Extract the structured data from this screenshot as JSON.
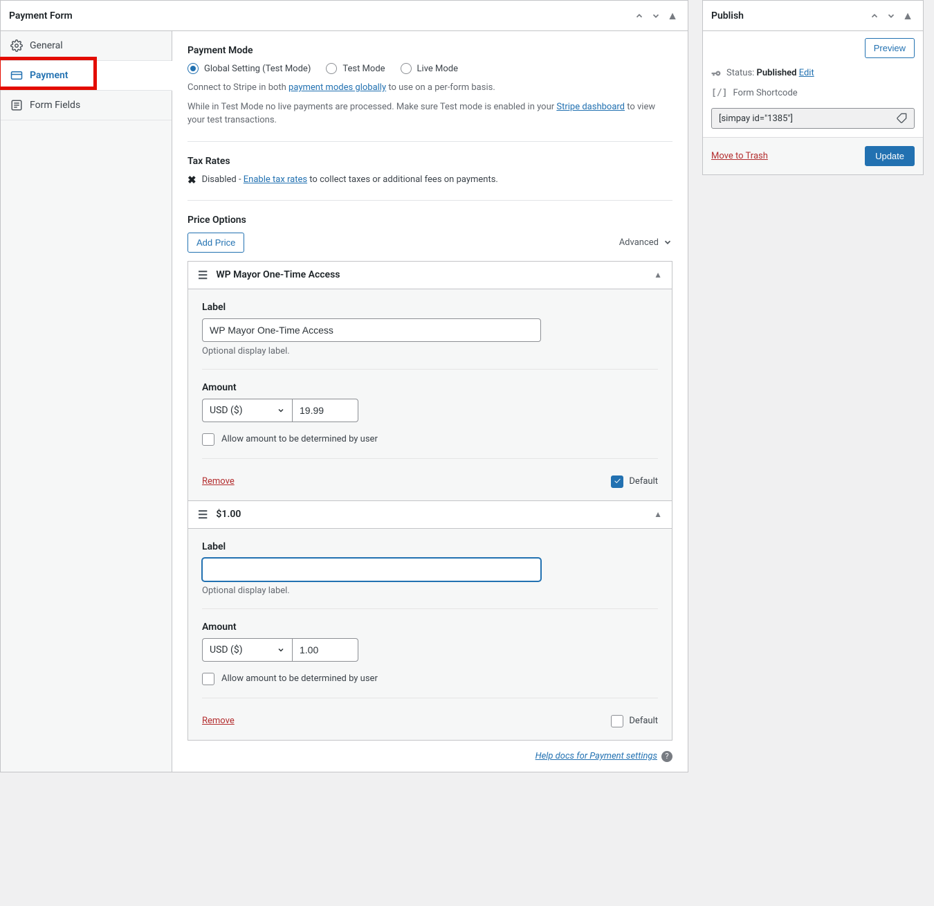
{
  "main": {
    "title": "Payment Form",
    "tabs": {
      "general": "General",
      "payment": "Payment",
      "form_fields": "Form Fields"
    },
    "payment_mode": {
      "heading": "Payment Mode",
      "options": {
        "global": "Global Setting (Test Mode)",
        "test": "Test Mode",
        "live": "Live Mode"
      },
      "desc1a": "Connect to Stripe in both ",
      "desc1_link": "payment modes globally",
      "desc1b": " to use on a per-form basis.",
      "desc2a": "While in Test Mode no live payments are processed. Make sure Test mode is enabled in your ",
      "desc2_link": "Stripe dashboard",
      "desc2b": " to view your test transactions."
    },
    "tax": {
      "heading": "Tax Rates",
      "disabled": "Disabled - ",
      "link": "Enable tax rates",
      "after": " to collect taxes or additional fees on payments."
    },
    "price": {
      "heading": "Price Options",
      "add_btn": "Add Price",
      "advanced": "Advanced",
      "items": [
        {
          "title": "WP Mayor One-Time Access",
          "label_heading": "Label",
          "label_value": "WP Mayor One-Time Access",
          "label_hint": "Optional display label.",
          "amount_heading": "Amount",
          "currency": "USD ($)",
          "amount": "19.99",
          "allow_user": "Allow amount to be determined by user",
          "remove": "Remove",
          "default_label": "Default",
          "default_checked": true
        },
        {
          "title": "$1.00",
          "label_heading": "Label",
          "label_value": "",
          "label_hint": "Optional display label.",
          "amount_heading": "Amount",
          "currency": "USD ($)",
          "amount": "1.00",
          "allow_user": "Allow amount to be determined by user",
          "remove": "Remove",
          "default_label": "Default",
          "default_checked": false
        }
      ]
    },
    "help_link": "Help docs for Payment settings"
  },
  "publish": {
    "title": "Publish",
    "preview": "Preview",
    "status_label": "Status: ",
    "status_value": "Published",
    "edit": "Edit",
    "shortcode_label": "Form Shortcode",
    "shortcode_value": "[simpay id=\"1385\"]",
    "trash": "Move to Trash",
    "update": "Update"
  }
}
